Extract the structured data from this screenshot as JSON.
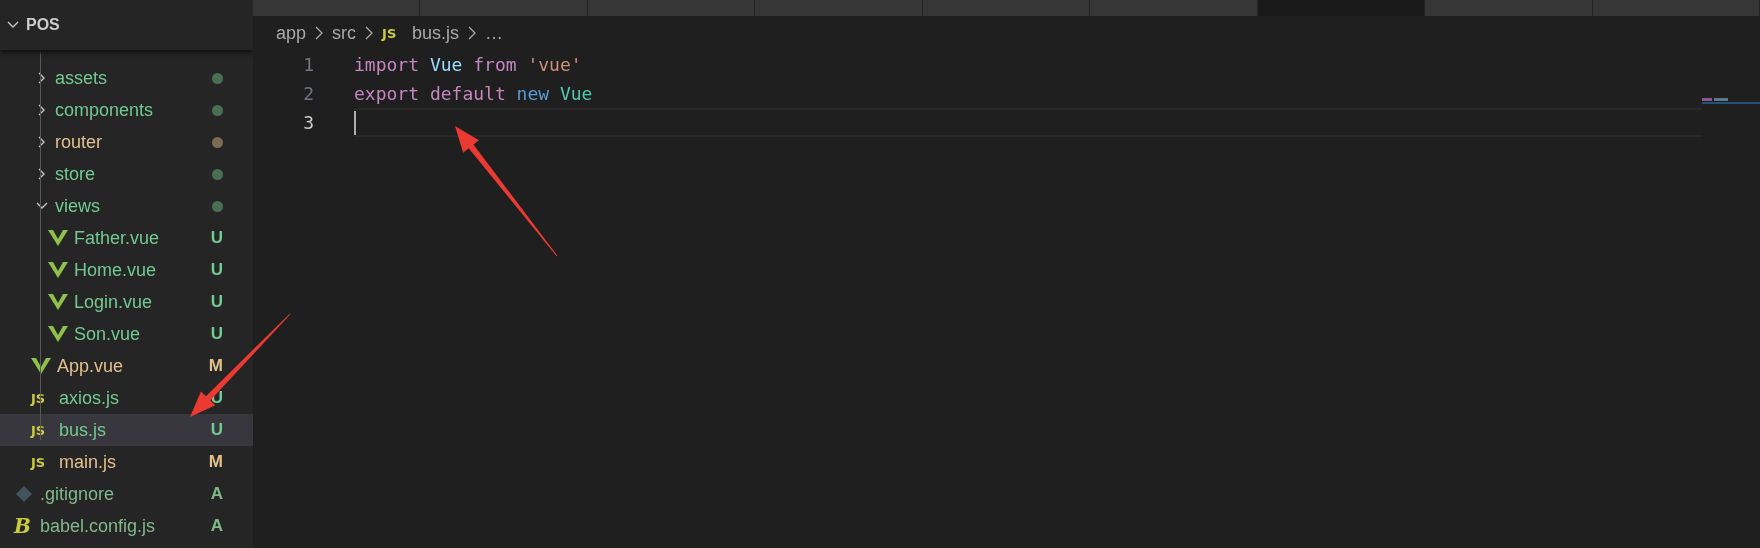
{
  "tabs": [
    {
      "selected": false
    },
    {
      "selected": false
    },
    {
      "selected": false
    },
    {
      "selected": false
    },
    {
      "selected": false
    },
    {
      "selected": false
    },
    {
      "selected": true
    },
    {
      "selected": false
    },
    {
      "selected": false
    }
  ],
  "explorer": {
    "title": "POS",
    "expanded": true
  },
  "tree": [
    {
      "children": [
        {
          "kind": "folder",
          "name": "assets",
          "expanded": false,
          "color": "#73c991",
          "selected": false
        },
        {
          "kind": "folder",
          "name": "components",
          "expanded": false,
          "color": "#73c991",
          "selected": false
        },
        {
          "kind": "folder",
          "name": "router",
          "expanded": false,
          "color": "#e2c08d",
          "selected": false
        },
        {
          "kind": "folder",
          "name": "store",
          "expanded": false,
          "color": "#73c991",
          "selected": false
        },
        {
          "kind": "folder",
          "name": "views",
          "expanded": true,
          "color": "#73c991",
          "selected": false,
          "children": [
            {
              "kind": "vue",
              "name": "Father.vue",
              "status": "U",
              "color": "#73c991",
              "selected": false
            },
            {
              "kind": "vue",
              "name": "Home.vue",
              "status": "U",
              "color": "#73c991",
              "selected": false
            },
            {
              "kind": "vue",
              "name": "Login.vue",
              "status": "U",
              "color": "#73c991",
              "selected": false
            },
            {
              "kind": "vue",
              "name": "Son.vue",
              "status": "U",
              "color": "#73c991",
              "selected": false
            }
          ]
        },
        {
          "kind": "vue",
          "name": "App.vue",
          "status": "M",
          "color": "#e2c08d",
          "selected": false
        },
        {
          "kind": "js",
          "icon_text": "JS",
          "name": "axios.js",
          "status": "U",
          "color": "#73c991",
          "selected": false
        },
        {
          "kind": "js",
          "icon_text": "JS",
          "name": "bus.js",
          "status": "U",
          "color": "#73c991",
          "selected": true
        },
        {
          "kind": "js",
          "icon_text": "JS",
          "name": "main.js",
          "status": "M",
          "color": "#e2c08d",
          "selected": false
        }
      ]
    },
    {
      "kind": "git",
      "name": ".gitignore",
      "status": "A",
      "color": "#81b88b",
      "selected": false
    },
    {
      "kind": "babel",
      "icon_text": "B",
      "name": "babel.config.js",
      "status": "A",
      "color": "#81b88b",
      "selected": false
    }
  ],
  "breadcrumb": [
    {
      "kind": "folder",
      "label": "app"
    },
    {
      "kind": "folder",
      "label": "src"
    },
    {
      "kind": "js",
      "icon_text": "JS",
      "label": "bus.js"
    },
    {
      "kind": "more",
      "label": "…"
    }
  ],
  "lines": [
    {
      "number": "1",
      "active": false,
      "tokens": [
        {
          "text": "import",
          "kind": "keyword"
        },
        {
          "text": "Vue",
          "kind": "variable"
        },
        {
          "text": "from",
          "kind": "keyword"
        },
        {
          "text": "'vue'",
          "kind": "string"
        }
      ]
    },
    {
      "number": "2",
      "active": false,
      "tokens": [
        {
          "text": "export",
          "kind": "keyword"
        },
        {
          "text": "default",
          "kind": "keyword"
        },
        {
          "text": "new",
          "kind": "storage"
        },
        {
          "text": "Vue",
          "kind": "class"
        }
      ]
    },
    {
      "number": "3",
      "active": true
    }
  ]
}
